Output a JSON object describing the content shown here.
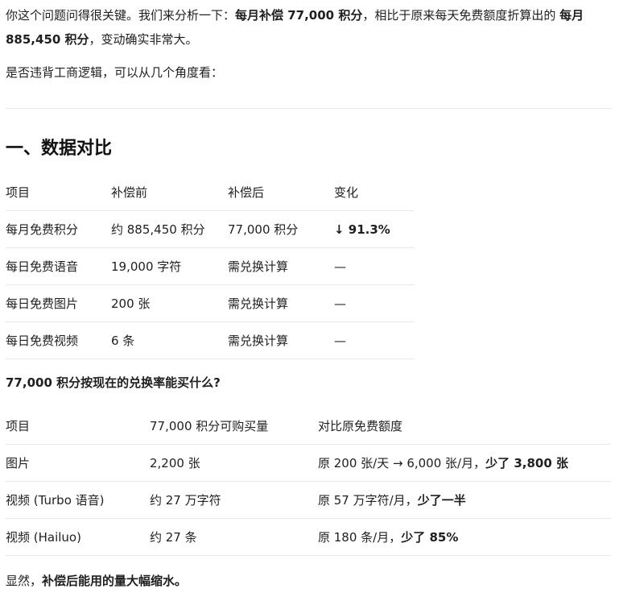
{
  "intro": {
    "part1": "你这个问题问得很关键。我们来分析一下：",
    "bold1": "每月补偿 77,000 积分",
    "part2": "，相比于原来每天免费额度折算出的 ",
    "bold2": "每月 885,450 积分",
    "part3": "，变动确实非常大。"
  },
  "lead": "是否违背工商逻辑，可以从几个角度看：",
  "section1": {
    "title": "一、数据对比",
    "headers": [
      "项目",
      "补偿前",
      "补偿后",
      "变化"
    ],
    "rows": [
      [
        "每月免费积分",
        "约 885,450 积分",
        "77,000 积分",
        "↓ 91.3%"
      ],
      [
        "每日免费语音",
        "19,000 字符",
        "需兑换计算",
        "—"
      ],
      [
        "每日免费图片",
        "200 张",
        "需兑换计算",
        "—"
      ],
      [
        "每日免费视频",
        "6 条",
        "需兑换计算",
        "—"
      ]
    ]
  },
  "section2": {
    "title": "77,000 积分按现在的兑换率能买什么?",
    "headers": [
      "项目",
      "77,000 积分可购买量",
      "对比原免费额度"
    ],
    "rows": [
      {
        "item": "图片",
        "amount": "2,200 张",
        "compare_plain": "原 200 张/天 → 6,000 张/月，",
        "compare_bold": "少了 3,800 张"
      },
      {
        "item": "视频 (Turbo 语音)",
        "amount": "约 27 万字符",
        "compare_plain": "原 57 万字符/月，",
        "compare_bold": "少了一半"
      },
      {
        "item": "视频 (Hailuo)",
        "amount": "约 27 条",
        "compare_plain": "原 180 条/月，",
        "compare_bold": "少了 85%"
      }
    ]
  },
  "conclusion": {
    "plain": "显然，",
    "bold": "补偿后能用的量大幅缩水。"
  }
}
